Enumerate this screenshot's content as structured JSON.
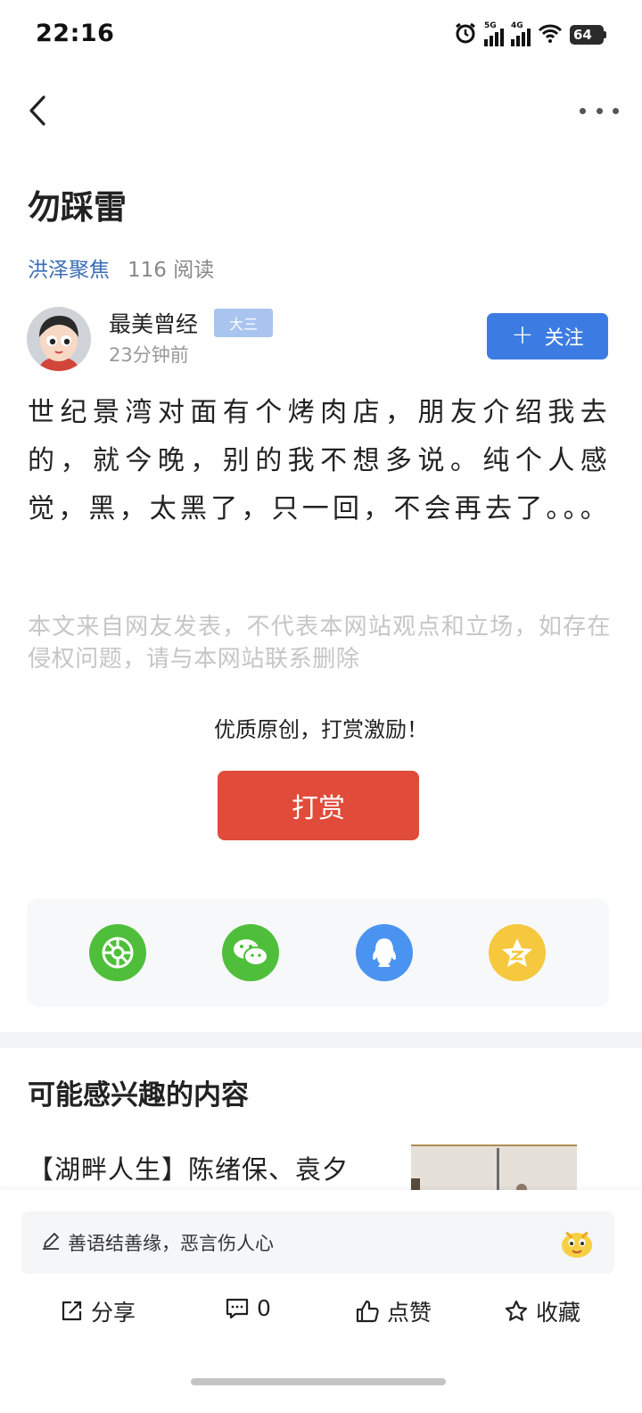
{
  "status_bar": {
    "time": "22:16",
    "sim1_label": "5G",
    "sim2_label": "4G",
    "battery": "64"
  },
  "nav": {
    "back_icon": "chevron-left-icon",
    "more_icon": "more-dots-icon"
  },
  "article": {
    "title": "勿踩雷",
    "source": "洪泽聚焦",
    "reads": "116 阅读",
    "author": {
      "name": "最美曾经",
      "badge": "大三",
      "time": "23分钟前",
      "follow_icon": "plus",
      "follow_label": "关注"
    },
    "body": "世纪景湾对面有个烤肉店，朋友介绍我去的，就今晚，别的我不想多说。纯个人感觉，黑，太黑了，只一回，不会再去了。。。",
    "disclaimer": "本文来自网友发表，不代表本网站观点和立场，如存在侵权问题，请与本网站联系删除"
  },
  "reward": {
    "prompt": "优质原创，打赏激励！",
    "button_label": "打赏"
  },
  "share": {
    "targets": [
      {
        "name": "moments-icon",
        "color": "#4fbf3b"
      },
      {
        "name": "wechat-icon",
        "color": "#4fbf3b"
      },
      {
        "name": "qq-icon",
        "color": "#4b93f0"
      },
      {
        "name": "qzone-icon",
        "color": "#f5c83d"
      }
    ]
  },
  "recommend": {
    "title": "可能感兴趣的内容",
    "items": [
      {
        "title": "【湖畔人生】陈绪保、袁夕"
      }
    ]
  },
  "bottom": {
    "comment_placeholder": "善语结善缘，恶言伤人心",
    "actions": {
      "share": "分享",
      "comments": "0",
      "like": "点赞",
      "favorite": "收藏"
    }
  },
  "colors": {
    "accent_blue": "#3c7be2",
    "reward_red": "#e04b3a",
    "source_blue": "#3a6db5"
  }
}
